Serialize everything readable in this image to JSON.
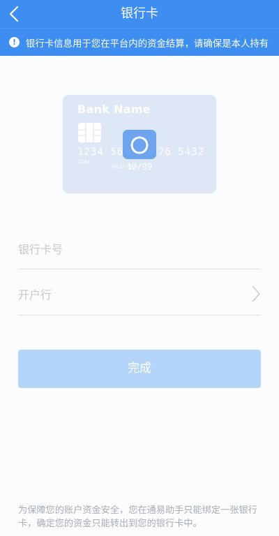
{
  "header": {
    "title": "银行卡",
    "back_icon": "chevron-left-icon"
  },
  "notice": {
    "icon": "exclamation-circle-icon",
    "text": "银行卡信息用于您在平台内的资金结算，请确保是本人持有"
  },
  "card_illustration": {
    "bank_name": "Bank Name",
    "number_left": "1234  56",
    "number_right": "76  5432",
    "small_number": "1234",
    "expiry_label": "VALID THRU",
    "expiry": "12/99",
    "camera_icon": "camera-icon"
  },
  "form": {
    "card_number_placeholder": "银行卡号",
    "bank_label": "开户行",
    "bank_chevron_icon": "chevron-right-icon"
  },
  "submit": {
    "label": "完成"
  },
  "footer": {
    "note": "为保障您的账户资金安全，您在通易助手只能绑定一张银行卡，确定您的资金只能转出到您的银行卡中。"
  },
  "colors": {
    "brand": "#3d8ef0",
    "button_disabled": "#b4d4f9",
    "card": "#dde7f5"
  }
}
